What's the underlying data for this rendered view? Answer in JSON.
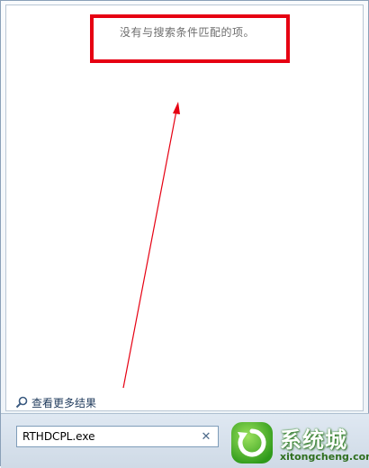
{
  "results": {
    "no_results_message": "没有与搜索条件匹配的项。"
  },
  "links": {
    "see_more_results": "查看更多结果"
  },
  "search": {
    "value": "RTHDCPL.exe"
  },
  "watermark": {
    "title": "系统城",
    "url": "xitongcheng.com"
  },
  "colors": {
    "highlight_box": "#e60012",
    "arrow": "#e60012",
    "link_text": "#1e395b",
    "message_text": "#6d6d6d"
  },
  "icons": {
    "search_link": "magnifier-icon",
    "clear": "close-icon",
    "logo": "circular-arrow-logo-icon"
  }
}
